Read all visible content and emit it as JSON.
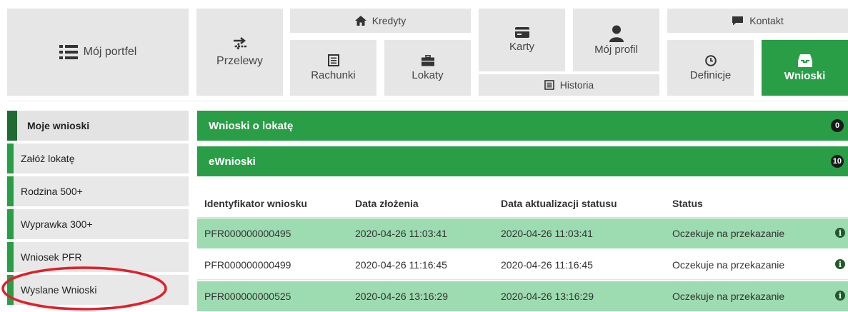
{
  "nav": {
    "moj_portfel": "Mój portfel",
    "przelewy": "Przelewy",
    "kredyty": "Kredyty",
    "rachunki": "Rachunki",
    "lokaty": "Lokaty",
    "karty": "Karty",
    "moj_profil": "Mój profil",
    "historia": "Historia",
    "kontakt": "Kontakt",
    "definicje": "Definicje",
    "wnioski": "Wnioski"
  },
  "sidebar": {
    "items": [
      {
        "label": "Moje wnioski"
      },
      {
        "label": "Załóż lokatę"
      },
      {
        "label": "Rodzina 500+"
      },
      {
        "label": "Wyprawka 300+"
      },
      {
        "label": "Wniosek PFR"
      },
      {
        "label": "Wyslane Wnioski"
      }
    ]
  },
  "panels": {
    "lokaty": {
      "title": "Wnioski o lokatę",
      "count": "0"
    },
    "ewnioski": {
      "title": "eWnioski",
      "count": "10"
    }
  },
  "table": {
    "headers": [
      "Identyfikator wniosku",
      "Data złożenia",
      "Data aktualizacji statusu",
      "Status"
    ],
    "rows": [
      [
        "PFR000000000495",
        "2020-04-26 11:03:41",
        "2020-04-26 11:03:41",
        "Oczekuje na przekazanie"
      ],
      [
        "PFR000000000499",
        "2020-04-26 11:16:45",
        "2020-04-26 11:16:45",
        "Oczekuje na przekazanie"
      ],
      [
        "PFR000000000525",
        "2020-04-26 13:16:29",
        "2020-04-26 13:16:29",
        "Oczekuje na przekazanie"
      ]
    ]
  },
  "colors": {
    "accent": "#2a9d47",
    "row_highlight": "#9ddbb1",
    "annotation": "#e0202a"
  }
}
